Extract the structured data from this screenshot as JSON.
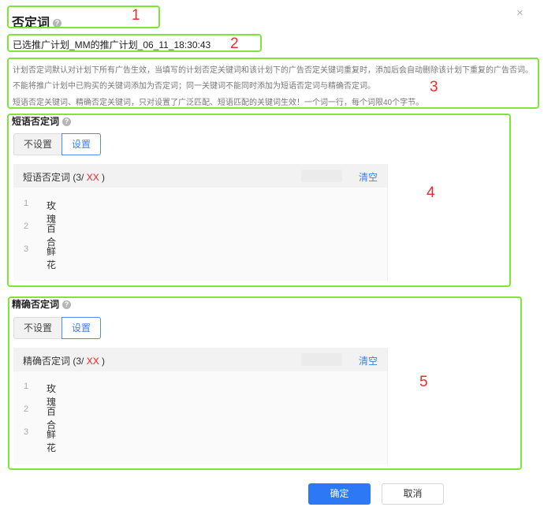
{
  "dialog": {
    "title": "否定词",
    "help_glyph": "?",
    "close_glyph": "×"
  },
  "plan": {
    "label": "已选推广计划_MM的推广计划_06_11_18:30:43"
  },
  "notes": [
    "计划否定词默认对计划下所有广告生效，当填写的计划否定关键词和该计划下的广告否定关键词重复时，添加后会自动删除该计划下重复的广告否词。",
    "不能将推广计划中已购买的关键词添加为否定词；同一关键词不能同时添加为短语否定词与精确否定词。",
    "短语否定关键词、精确否定关键词，只对设置了广泛匹配、短语匹配的关键词生效！一个词一行，每个词限40个字节。"
  ],
  "phrase": {
    "title": "短语否定词",
    "options": [
      "不设置",
      "设置"
    ],
    "list_label": "短语否定词 (3/",
    "list_max": "XX",
    "list_close": ")",
    "clear_label": "清空",
    "items": [
      {
        "num": "1",
        "text": "玫瑰"
      },
      {
        "num": "2",
        "text": "百合"
      },
      {
        "num": "3",
        "text": "鲜花"
      }
    ]
  },
  "exact": {
    "title": "精确否定词",
    "options": [
      "不设置",
      "设置"
    ],
    "list_label": "精确否定词 (3/",
    "list_max": "XX",
    "list_close": ")",
    "clear_label": "清空",
    "items": [
      {
        "num": "1",
        "text": "玫瑰"
      },
      {
        "num": "2",
        "text": "百合"
      },
      {
        "num": "3",
        "text": "鲜花"
      }
    ]
  },
  "footer": {
    "confirm_label": "确定",
    "cancel_label": "取消"
  },
  "callouts": [
    "1",
    "2",
    "3",
    "4",
    "5"
  ],
  "colors": {
    "annotation_box": "#7ee63a",
    "annotation_number": "#ee2b2b",
    "accent": "#2d78f4",
    "link": "#3b7fe8"
  }
}
